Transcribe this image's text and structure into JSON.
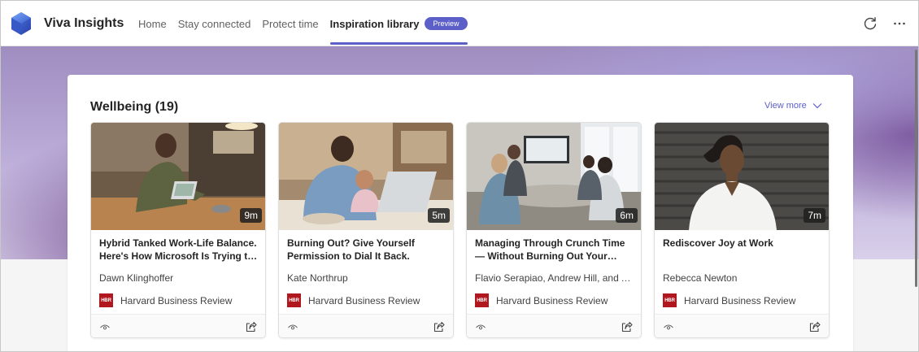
{
  "header": {
    "app_title": "Viva Insights",
    "nav": [
      {
        "label": "Home"
      },
      {
        "label": "Stay connected"
      },
      {
        "label": "Protect time"
      }
    ],
    "active_nav": {
      "label": "Inspiration library",
      "badge": "Preview"
    },
    "icons": {
      "refresh": "refresh-icon",
      "more": "more-icon"
    }
  },
  "section": {
    "title": "Wellbeing (19)",
    "view_more": "View more"
  },
  "cards": [
    {
      "duration": "9m",
      "title": "Hybrid Tanked Work-Life Balance. Here's How Microsoft Is Trying to Fix It.",
      "author": "Dawn Klinghoffer",
      "source_logo": "HBR",
      "source": "Harvard Business Review",
      "image": "man working on laptop in kitchen"
    },
    {
      "duration": "5m",
      "title": "Burning Out? Give Yourself Permission to Dial It Back.",
      "author": "Kate Northrup",
      "source_logo": "HBR",
      "source": "Harvard Business Review",
      "image": "father with baby at laptop"
    },
    {
      "duration": "6m",
      "title": "Managing Through Crunch Time — Without Burning Out Your Team",
      "author": "Flavio Serapiao, Andrew Hill, and Andy Sugden",
      "source_logo": "HBR",
      "source": "Harvard Business Review",
      "image": "team meeting in conference room"
    },
    {
      "duration": "7m",
      "title": "Rediscover Joy at Work",
      "author": "Rebecca Newton",
      "source_logo": "HBR",
      "source": "Harvard Business Review",
      "image": "smiling woman in white shirt"
    }
  ],
  "colors": {
    "accent": "#5b5fc7",
    "hbr_red": "#b0171f"
  }
}
